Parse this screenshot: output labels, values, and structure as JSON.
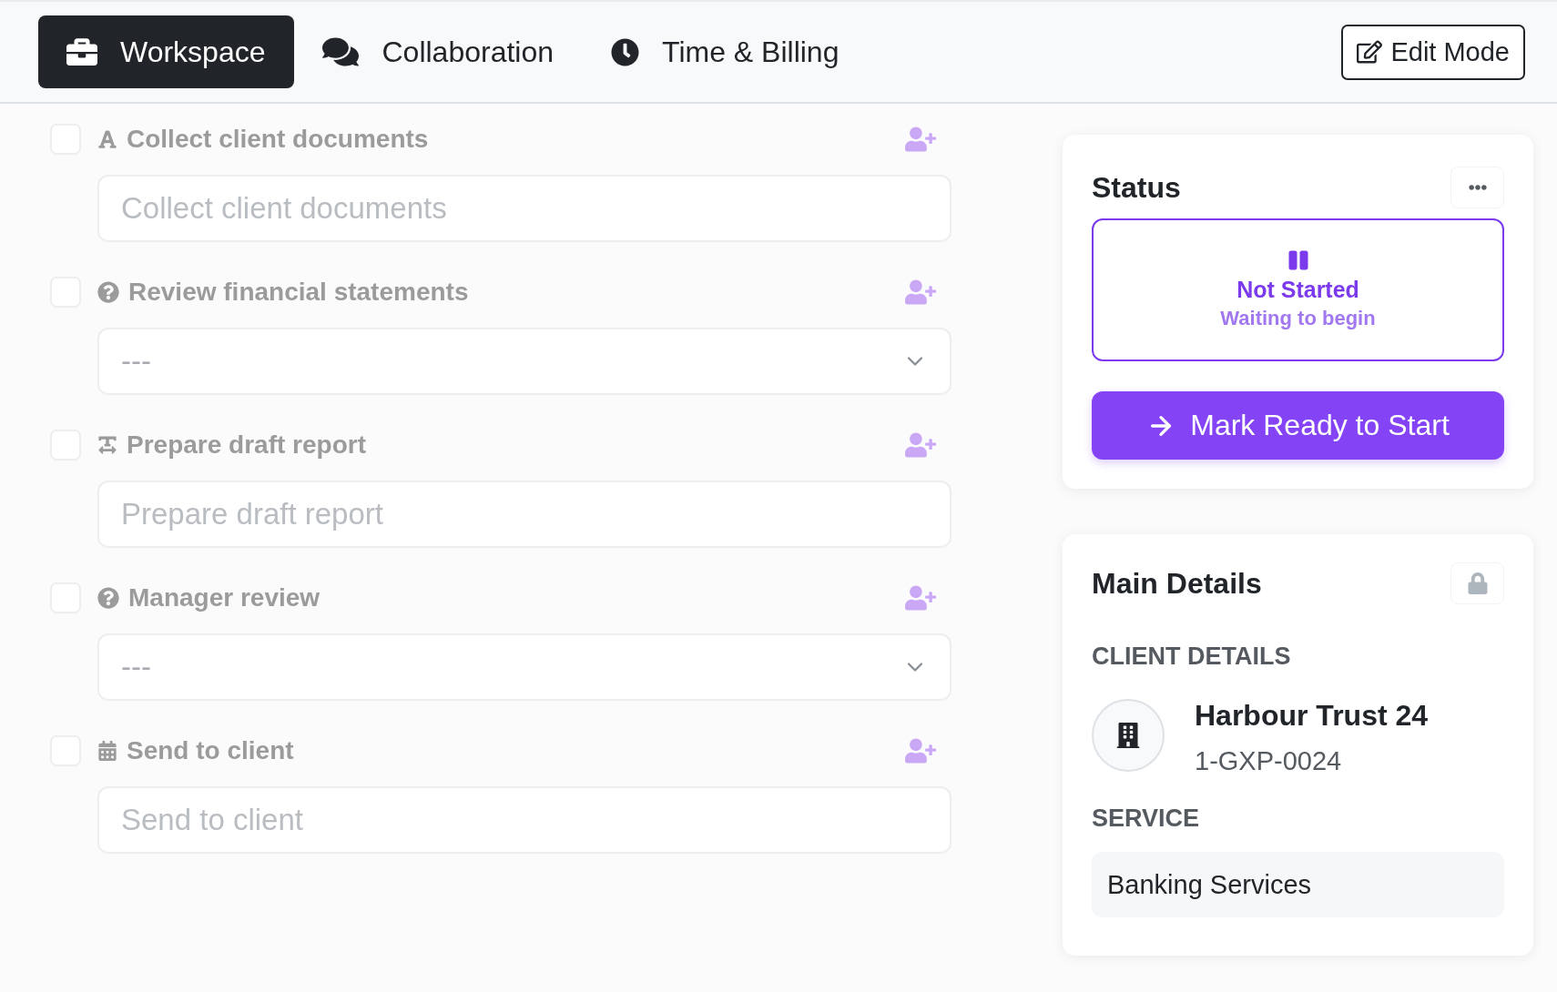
{
  "tabs": [
    {
      "label": "Workspace",
      "selected": true
    },
    {
      "label": "Collaboration",
      "selected": false
    },
    {
      "label": "Time & Billing",
      "selected": false
    }
  ],
  "edit_button": {
    "label": "Edit Mode"
  },
  "tasks": [
    {
      "label": "Collect client documents",
      "kind": "text",
      "checked": false,
      "disabled": true,
      "placeholder": "Collect client documents"
    },
    {
      "label": "Review financial statements",
      "kind": "select",
      "checked": false,
      "disabled": true,
      "placeholder": "---"
    },
    {
      "label": "Prepare draft report",
      "kind": "paragraph",
      "checked": false,
      "disabled": true,
      "placeholder": "Prepare draft report"
    },
    {
      "label": "Manager review",
      "kind": "select",
      "checked": false,
      "disabled": true,
      "placeholder": "---"
    },
    {
      "label": "Send to client",
      "kind": "date",
      "checked": false,
      "disabled": true,
      "placeholder": "Send to client"
    }
  ],
  "status_card": {
    "title": "Status",
    "state": {
      "kind": "not_started",
      "label": "Not Started",
      "detail": "Waiting to begin"
    },
    "action": {
      "label": "Mark Ready to Start"
    }
  },
  "details_card": {
    "title": "Main Details",
    "locked": true,
    "client_section": {
      "heading": "CLIENT DETAILS",
      "name": "Harbour Trust 24",
      "code": "1-GXP-0024"
    },
    "service_section": {
      "heading": "SERVICE",
      "value": "Banking Services"
    }
  }
}
